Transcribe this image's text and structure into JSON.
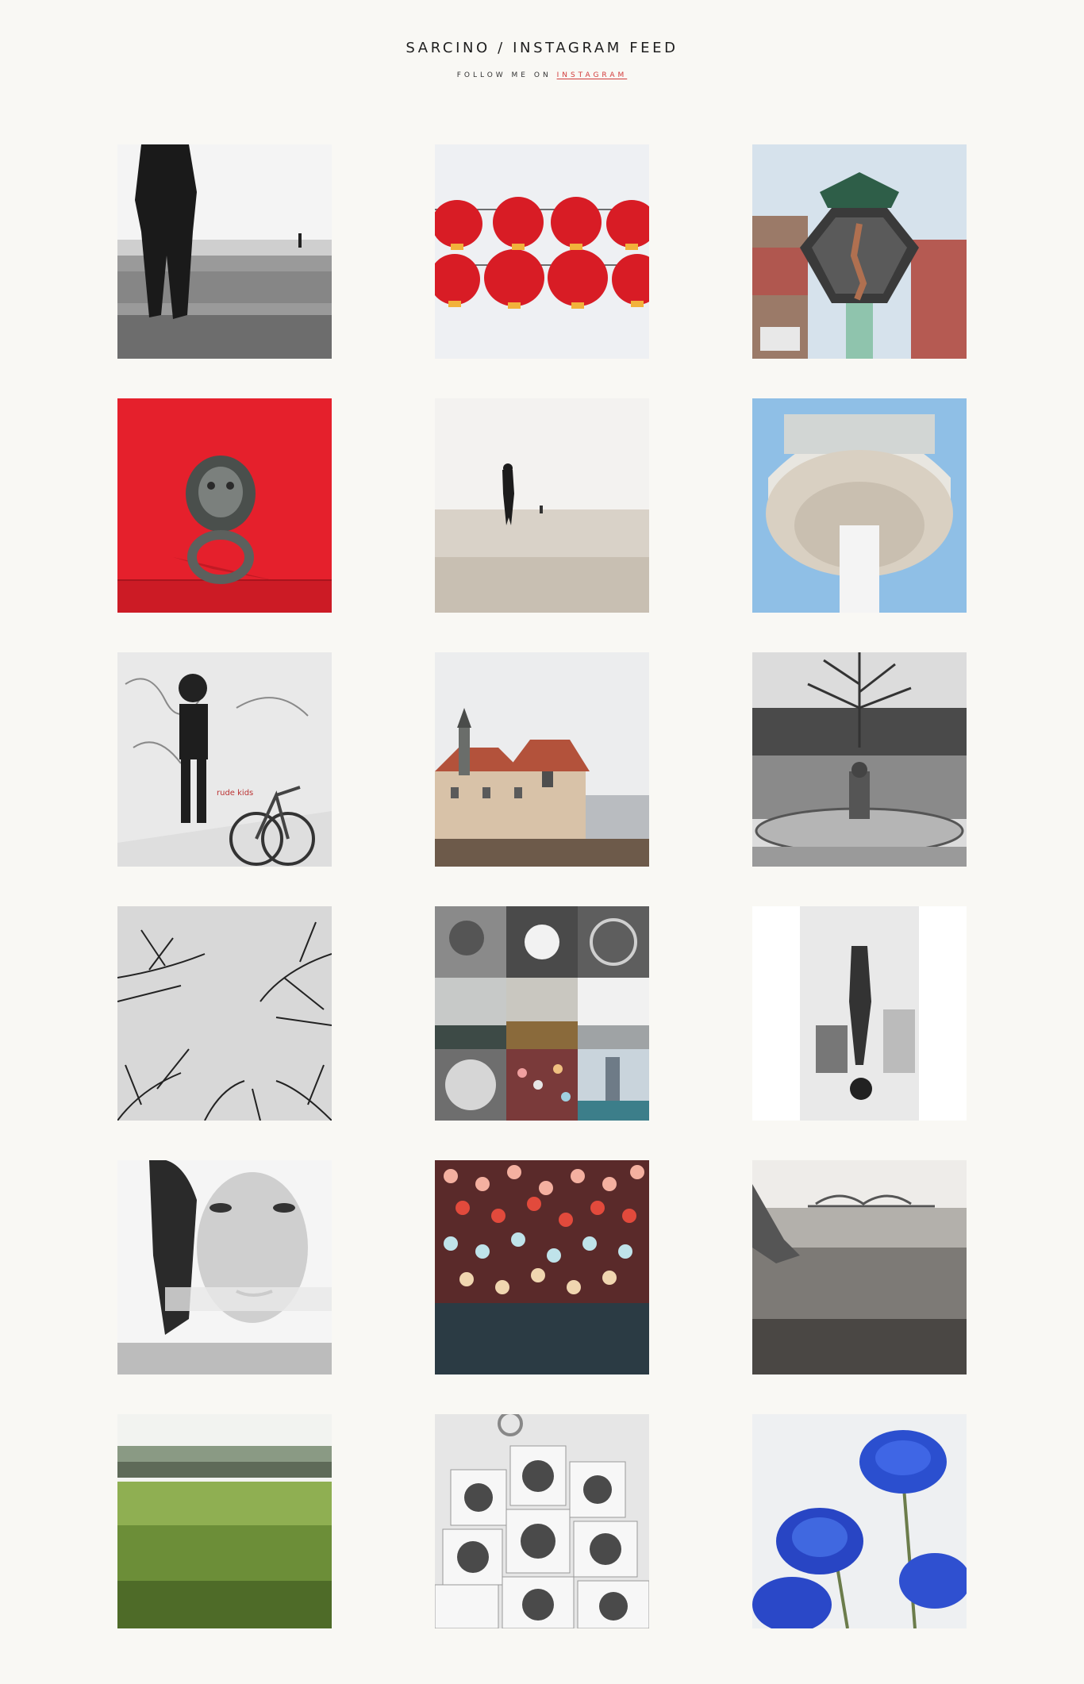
{
  "header": {
    "title": "SARCINO / INSTAGRAM FEED",
    "follow_prefix": "FOLLOW ME ON",
    "follow_link": "INSTAGRAM"
  },
  "colors": {
    "background": "#f9f8f4",
    "link": "#d23b3b"
  },
  "photos": [
    {
      "subject": "beach-statue-bw"
    },
    {
      "subject": "red-lanterns"
    },
    {
      "subject": "ornate-street-lamp"
    },
    {
      "subject": "lion-door-knocker-red"
    },
    {
      "subject": "statue-in-sea"
    },
    {
      "subject": "radio-tower"
    },
    {
      "subject": "street-art-boy-bicycle"
    },
    {
      "subject": "castle-on-hill"
    },
    {
      "subject": "park-fountain-bw"
    },
    {
      "subject": "bare-trees-sky-bw"
    },
    {
      "subject": "photo-collage"
    },
    {
      "subject": "upside-down-dancer"
    },
    {
      "subject": "woman-portrait-bw"
    },
    {
      "subject": "candles-lights"
    },
    {
      "subject": "misty-river-bridge"
    },
    {
      "subject": "green-meadow"
    },
    {
      "subject": "washing-machines-sculpture"
    },
    {
      "subject": "blue-flowers"
    }
  ]
}
